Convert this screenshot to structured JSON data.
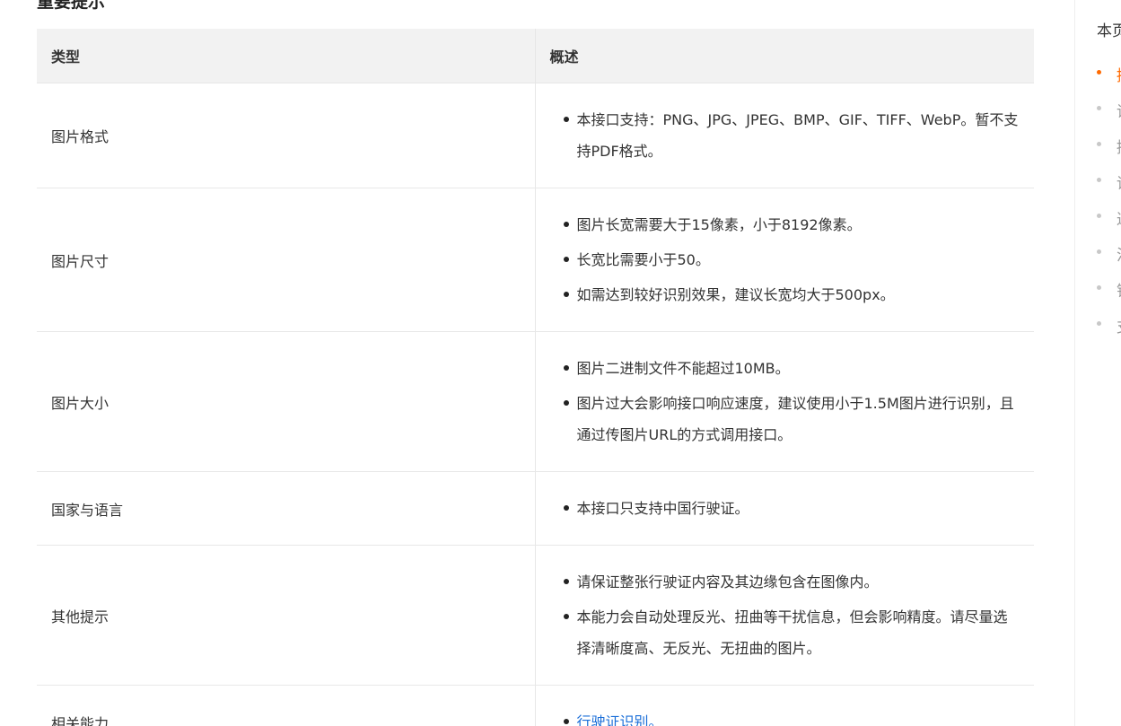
{
  "section_title": "重要提示",
  "table": {
    "headers": [
      "类型",
      "概述"
    ],
    "rows": [
      {
        "type": "图片格式",
        "items": [
          "本接口支持：PNG、JPG、JPEG、BMP、GIF、TIFF、WebP。暂不支持PDF格式。"
        ]
      },
      {
        "type": "图片尺寸",
        "items": [
          "图片长宽需要大于15像素，小于8192像素。",
          "长宽比需要小于50。",
          "如需达到较好识别效果，建议长宽均大于500px。"
        ]
      },
      {
        "type": "图片大小",
        "items": [
          "图片二进制文件不能超过10MB。",
          "图片过大会影响接口响应速度，建议使用小于1.5M图片进行识别，且通过传图片URL的方式调用接口。"
        ]
      },
      {
        "type": "国家与语言",
        "items": [
          "本接口只支持中国行驶证。"
        ]
      },
      {
        "type": "其他提示",
        "items": [
          "请保证整张行驶证内容及其边缘包含在图像内。",
          "本能力会自动处理反光、扭曲等干扰信息，但会影响精度。请尽量选择清晰度高、无反光、无扭曲的图片。"
        ]
      },
      {
        "type": "相关能力",
        "link": "行驶证识别。"
      }
    ]
  },
  "toc": {
    "title": "本页",
    "items": [
      {
        "label": "接",
        "active": true
      },
      {
        "label": "请",
        "active": false
      },
      {
        "label": "接",
        "active": false
      },
      {
        "label": "请",
        "active": false
      },
      {
        "label": "返",
        "active": false
      },
      {
        "label": "注",
        "active": false
      },
      {
        "label": "错",
        "active": false
      },
      {
        "label": "支",
        "active": false
      }
    ]
  },
  "colors": {
    "accent": "#ff6a00",
    "link": "#1a6ed8",
    "header_bg": "#f2f2f2"
  }
}
